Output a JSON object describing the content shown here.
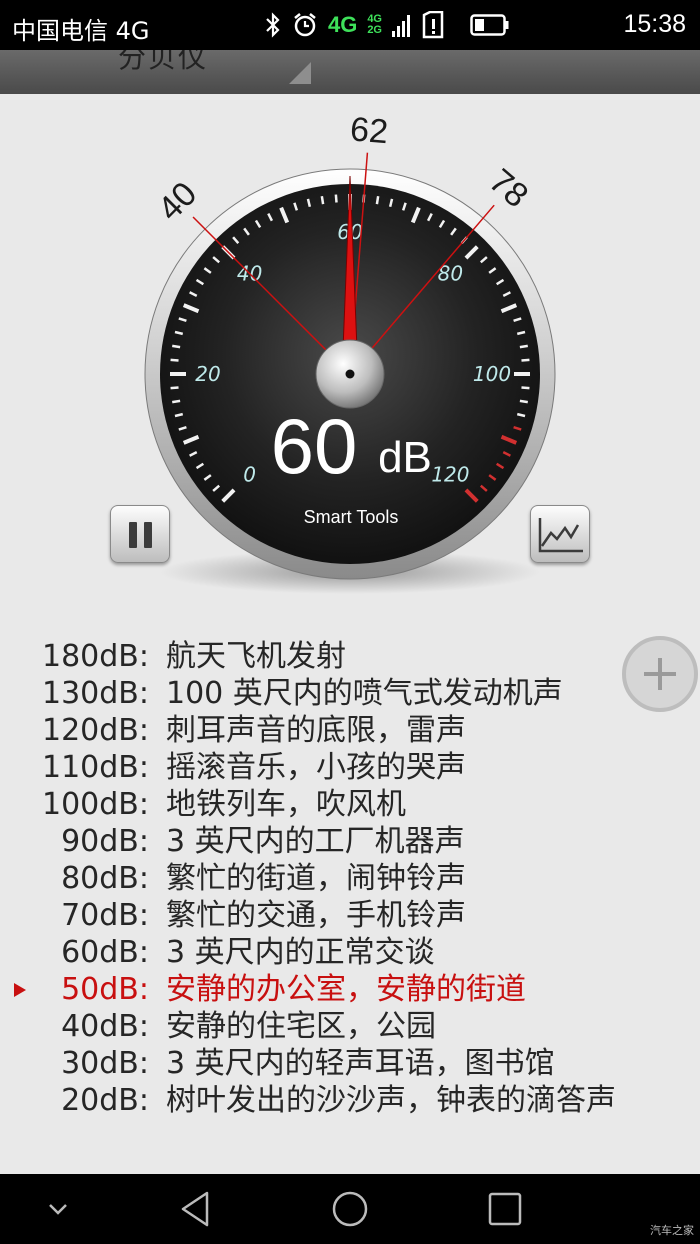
{
  "status_bar": {
    "carrier": "中国电信 4G",
    "network_primary": "4G",
    "network_secondary_top": "4G",
    "network_secondary_bottom": "2G",
    "time": "15:38",
    "icons": [
      "bluetooth-icon",
      "alarm-icon",
      "signal-icon",
      "sim-icon",
      "battery-icon"
    ]
  },
  "header": {
    "title": "分贝仪"
  },
  "gauge": {
    "reading_value": "60",
    "reading_unit": "dB",
    "brand": "Smart Tools",
    "scale_min": 0,
    "scale_max": 120,
    "scale_labels": [
      "0",
      "20",
      "40",
      "60",
      "80",
      "100",
      "120"
    ],
    "current_db": 60,
    "min_marker": {
      "value": 40,
      "label": "40"
    },
    "avg_marker": {
      "value": 62,
      "label": "62"
    },
    "max_marker": {
      "value": 78,
      "label": "78"
    },
    "colors": {
      "dial": "#141414",
      "scale_text": "#bfe9ea",
      "needle": "#dd1111",
      "warning_ticks": "#d23030",
      "marker_lines": "#cc1111"
    }
  },
  "buttons": {
    "pause": "pause-icon",
    "chart": "chart-icon",
    "add": "plus-icon"
  },
  "reference": {
    "current_index": 9,
    "rows": [
      {
        "level": "180dB:",
        "desc": "航天飞机发射"
      },
      {
        "level": "130dB:",
        "desc": "100 英尺内的喷气式发动机声"
      },
      {
        "level": "120dB:",
        "desc": "刺耳声音的底限，雷声"
      },
      {
        "level": "110dB:",
        "desc": "摇滚音乐，小孩的哭声"
      },
      {
        "level": "100dB:",
        "desc": "地铁列车，吹风机"
      },
      {
        "level": "90dB:",
        "desc": "3 英尺内的工厂机器声"
      },
      {
        "level": "80dB:",
        "desc": "繁忙的街道，闹钟铃声"
      },
      {
        "level": "70dB:",
        "desc": "繁忙的交通，手机铃声"
      },
      {
        "level": "60dB:",
        "desc": "3 英尺内的正常交谈"
      },
      {
        "level": "50dB:",
        "desc": "安静的办公室，安静的街道"
      },
      {
        "level": "40dB:",
        "desc": "安静的住宅区，公园"
      },
      {
        "level": "30dB:",
        "desc": "3 英尺内的轻声耳语，图书馆"
      },
      {
        "level": "20dB:",
        "desc": "树叶发出的沙沙声，钟表的滴答声"
      }
    ]
  },
  "nav_bar": {
    "items": [
      "chevron-down-icon",
      "back-icon",
      "home-icon",
      "recents-icon"
    ],
    "watermark": "汽车之家"
  }
}
